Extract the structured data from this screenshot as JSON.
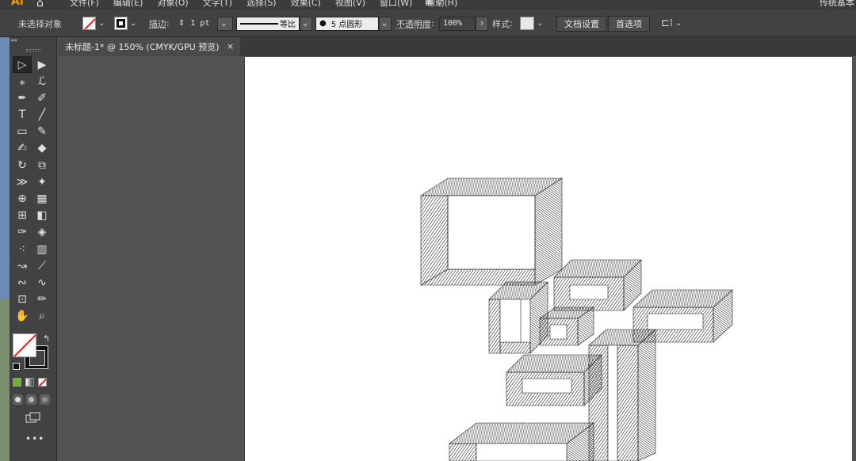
{
  "menubar": {
    "app_logo": "Ai",
    "home_icon": "home-icon",
    "items": [
      "文件(F)",
      "编辑(E)",
      "对象(O)",
      "文字(T)",
      "选择(S)",
      "效果(C)",
      "视图(V)",
      "窗口(W)",
      "帮助(H)"
    ],
    "workspace_icon": "workspace-switcher-icon",
    "right_text": "传统基本"
  },
  "controlbar": {
    "selection_label": "未选择对象",
    "stroke_label": "描边",
    "stroke_weight": "1 pt",
    "stroke_profile": "等比",
    "brush_definition": "5 点圆形",
    "opacity_label": "不透明度",
    "opacity_value": "100%",
    "style_label": "样式",
    "doc_setup_button": "文档设置",
    "preferences_button": "首选项",
    "arrange_icon": "arrange-documents-icon"
  },
  "toolpanel": {
    "collapse_label": "◂◂",
    "more_label": "•••",
    "tools": [
      {
        "name": "selection-tool",
        "glyph": "▷",
        "active": true
      },
      {
        "name": "direct-selection-tool",
        "glyph": "▶",
        "active": false
      },
      {
        "name": "magic-wand-tool",
        "glyph": "⁎",
        "active": false
      },
      {
        "name": "lasso-tool",
        "glyph": "ℒ",
        "active": false
      },
      {
        "name": "pen-tool",
        "glyph": "✒",
        "active": false
      },
      {
        "name": "curvature-tool",
        "glyph": "✐",
        "active": false
      },
      {
        "name": "type-tool",
        "glyph": "T",
        "active": false
      },
      {
        "name": "line-segment-tool",
        "glyph": "╱",
        "active": false
      },
      {
        "name": "rectangle-tool",
        "glyph": "▭",
        "active": false
      },
      {
        "name": "paintbrush-tool",
        "glyph": "✎",
        "active": false
      },
      {
        "name": "shaper-tool",
        "glyph": "✍",
        "active": false
      },
      {
        "name": "eraser-tool",
        "glyph": "◆",
        "active": false
      },
      {
        "name": "rotate-tool",
        "glyph": "↻",
        "active": false
      },
      {
        "name": "scale-tool",
        "glyph": "⧉",
        "active": false
      },
      {
        "name": "width-tool",
        "glyph": "≫",
        "active": false
      },
      {
        "name": "puppet-warp-tool",
        "glyph": "✦",
        "active": false
      },
      {
        "name": "shape-builder-tool",
        "glyph": "⊕",
        "active": false
      },
      {
        "name": "perspective-grid-tool",
        "glyph": "▦",
        "active": false
      },
      {
        "name": "mesh-tool",
        "glyph": "⊞",
        "active": false
      },
      {
        "name": "gradient-tool",
        "glyph": "◧",
        "active": false
      },
      {
        "name": "eyedropper-tool",
        "glyph": "✑",
        "active": false
      },
      {
        "name": "blend-tool",
        "glyph": "◈",
        "active": false
      },
      {
        "name": "symbol-sprayer-tool",
        "glyph": "⁖",
        "active": false
      },
      {
        "name": "column-graph-tool",
        "glyph": "▥",
        "active": false
      },
      {
        "name": "anchor-point-tool",
        "glyph": "↝",
        "active": false
      },
      {
        "name": "slice-tool",
        "glyph": "⟋",
        "active": false
      },
      {
        "name": "join-tool",
        "glyph": "∾",
        "active": false
      },
      {
        "name": "smooth-tool",
        "glyph": "∿",
        "active": false
      },
      {
        "name": "artboard-tool",
        "glyph": "⊡",
        "active": false
      },
      {
        "name": "pencil-tool",
        "glyph": "✏",
        "active": false
      },
      {
        "name": "hand-tool",
        "glyph": "✋",
        "active": false
      },
      {
        "name": "zoom-tool",
        "glyph": "⌕",
        "active": false
      }
    ]
  },
  "document_tab": {
    "title": "未标题-1* @ 150% (CMYK/GPU 预览)",
    "close_label": "×"
  },
  "colors": {
    "menubar_bg": "#3c3c3c",
    "panel_bg": "#424242",
    "workspace_bg": "#535353",
    "artboard_bg": "#ffffff",
    "accent_logo": "#ff9a00",
    "none_swatch_slash": "#e0201b"
  }
}
